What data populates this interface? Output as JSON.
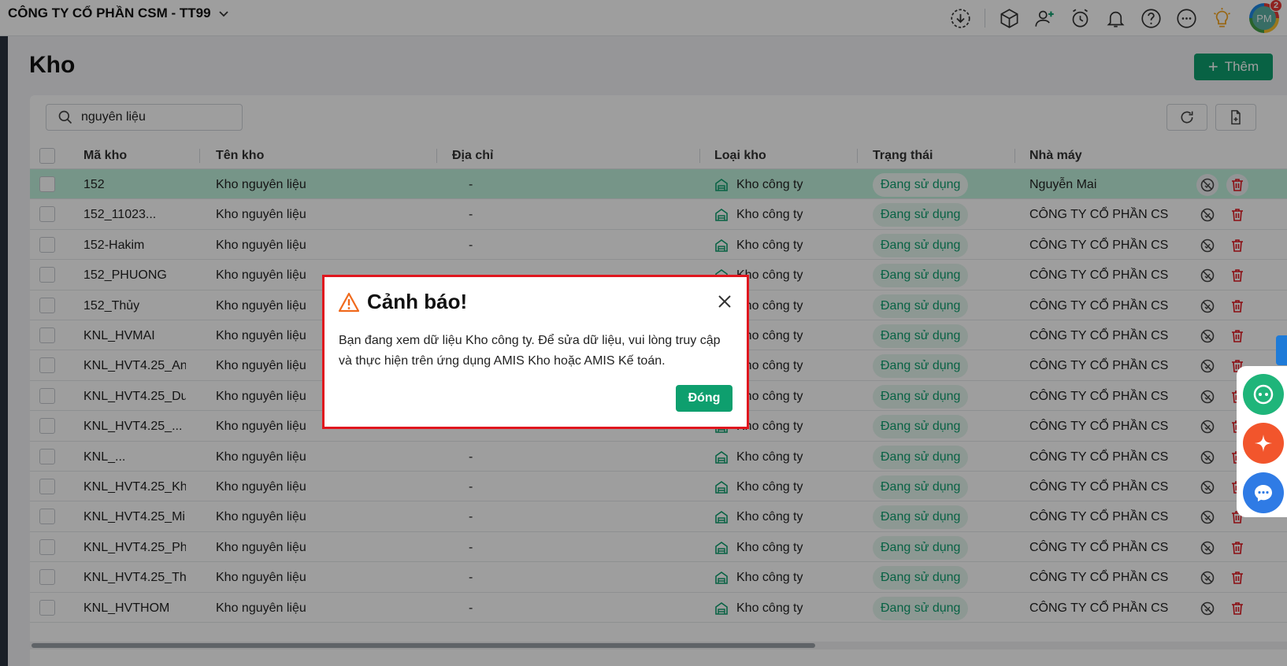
{
  "header": {
    "company_name": "CÔNG TY CỔ PHẦN CSM - TT99",
    "icons": [
      "download-icon",
      "box-icon",
      "add-user-icon",
      "alarm-icon",
      "bell-icon",
      "help-icon",
      "more-icon",
      "lightbulb-icon"
    ],
    "avatar_initials": "PM",
    "notification_count": "2"
  },
  "page": {
    "title": "Kho",
    "add_label": "Thêm"
  },
  "toolbar": {
    "search_value": "nguyên liệu"
  },
  "table": {
    "columns": [
      "Mã kho",
      "Tên kho",
      "Địa chỉ",
      "Loại kho",
      "Trạng thái",
      "Nhà máy"
    ],
    "rows": [
      {
        "code": "152",
        "name": "Kho nguyên liệu",
        "address": "-",
        "type": "Kho công ty",
        "status": "Đang sử dụng",
        "factory": "Nguyễn Mai"
      },
      {
        "code": "152_11023...",
        "name": "Kho nguyên liệu",
        "address": "-",
        "type": "Kho công ty",
        "status": "Đang sử dụng",
        "factory": "CÔNG TY CỔ PHẦN CS"
      },
      {
        "code": "152-Hakim",
        "name": "Kho nguyên liệu",
        "address": "-",
        "type": "Kho công ty",
        "status": "Đang sử dụng",
        "factory": "CÔNG TY CỔ PHẦN CS"
      },
      {
        "code": "152_PHUONG",
        "name": "Kho nguyên liệu",
        "address": "-",
        "type": "Kho công ty",
        "status": "Đang sử dụng",
        "factory": "CÔNG TY CỔ PHẦN CS"
      },
      {
        "code": "152_Thủy",
        "name": "Kho nguyên liệu",
        "address": "-",
        "type": "Kho công ty",
        "status": "Đang sử dụng",
        "factory": "CÔNG TY CỔ PHẦN CS"
      },
      {
        "code": "KNL_HVMAI",
        "name": "Kho nguyên liệu",
        "address": "-",
        "type": "Kho công ty",
        "status": "Đang sử dụng",
        "factory": "CÔNG TY CỔ PHẦN CS"
      },
      {
        "code": "KNL_HVT4.25_An",
        "name": "Kho nguyên liệu",
        "address": "-",
        "type": "Kho công ty",
        "status": "Đang sử dụng",
        "factory": "CÔNG TY CỔ PHẦN CS"
      },
      {
        "code": "KNL_HVT4.25_Du",
        "name": "Kho nguyên liệu",
        "address": "-",
        "type": "Kho công ty",
        "status": "Đang sử dụng",
        "factory": "CÔNG TY CỔ PHẦN CS"
      },
      {
        "code": "KNL_HVT4.25_...",
        "name": "Kho nguyên liệu",
        "address": "-",
        "type": "Kho công ty",
        "status": "Đang sử dụng",
        "factory": "CÔNG TY CỔ PHẦN CS"
      },
      {
        "code": "KNL_...",
        "name": "Kho nguyên liệu",
        "address": "-",
        "type": "Kho công ty",
        "status": "Đang sử dụng",
        "factory": "CÔNG TY CỔ PHẦN CS"
      },
      {
        "code": "KNL_HVT4.25_Kh",
        "name": "Kho nguyên liệu",
        "address": "-",
        "type": "Kho công ty",
        "status": "Đang sử dụng",
        "factory": "CÔNG TY CỔ PHẦN CS"
      },
      {
        "code": "KNL_HVT4.25_Mi",
        "name": "Kho nguyên liệu",
        "address": "-",
        "type": "Kho công ty",
        "status": "Đang sử dụng",
        "factory": "CÔNG TY CỔ PHẦN CS"
      },
      {
        "code": "KNL_HVT4.25_Ph",
        "name": "Kho nguyên liệu",
        "address": "-",
        "type": "Kho công ty",
        "status": "Đang sử dụng",
        "factory": "CÔNG TY CỔ PHẦN CS"
      },
      {
        "code": "KNL_HVT4.25_Th",
        "name": "Kho nguyên liệu",
        "address": "-",
        "type": "Kho công ty",
        "status": "Đang sử dụng",
        "factory": "CÔNG TY CỔ PHẦN CS"
      },
      {
        "code": "KNL_HVTHOM",
        "name": "Kho nguyên liệu",
        "address": "-",
        "type": "Kho công ty",
        "status": "Đang sử dụng",
        "factory": "CÔNG TY CỔ PHẦN CS"
      }
    ],
    "selected_row": 0
  },
  "modal": {
    "title": "Cảnh báo!",
    "message": "Bạn đang xem dữ liệu Kho công ty. Để sửa dữ liệu, vui lòng truy cập và thực hiện trên ứng dụng AMIS Kho hoặc AMIS Kế toán.",
    "ok_label": "Đóng"
  },
  "colors": {
    "accent": "#0e9f6e",
    "danger": "#e0161e",
    "selected_row": "#bff0dc",
    "warning": "#f06a1d"
  },
  "side_widgets": [
    "chat-bot-icon",
    "ai-sparkle-icon",
    "messenger-icon"
  ]
}
